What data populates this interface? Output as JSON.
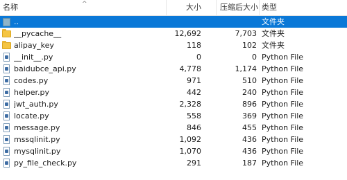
{
  "columns": {
    "name": "名称",
    "size": "大小",
    "compressed": "压缩后大小",
    "type": "类型"
  },
  "rows": [
    {
      "name": "..",
      "size": "",
      "compressed": "",
      "type": "文件夹",
      "icon": "parent-folder-icon"
    },
    {
      "name": "__pycache__",
      "size": "12,692",
      "compressed": "7,703",
      "type": "文件夹",
      "icon": "folder-icon"
    },
    {
      "name": "alipay_key",
      "size": "118",
      "compressed": "102",
      "type": "文件夹",
      "icon": "folder-icon"
    },
    {
      "name": "__init__.py",
      "size": "0",
      "compressed": "0",
      "type": "Python File",
      "icon": "python-file-icon"
    },
    {
      "name": "baidubce_api.py",
      "size": "4,778",
      "compressed": "1,174",
      "type": "Python File",
      "icon": "python-file-icon"
    },
    {
      "name": "codes.py",
      "size": "971",
      "compressed": "510",
      "type": "Python File",
      "icon": "python-file-icon"
    },
    {
      "name": "helper.py",
      "size": "442",
      "compressed": "240",
      "type": "Python File",
      "icon": "python-file-icon"
    },
    {
      "name": "jwt_auth.py",
      "size": "2,328",
      "compressed": "896",
      "type": "Python File",
      "icon": "python-file-icon"
    },
    {
      "name": "locate.py",
      "size": "558",
      "compressed": "369",
      "type": "Python File",
      "icon": "python-file-icon"
    },
    {
      "name": "message.py",
      "size": "846",
      "compressed": "455",
      "type": "Python File",
      "icon": "python-file-icon"
    },
    {
      "name": "mssqlinit.py",
      "size": "1,092",
      "compressed": "436",
      "type": "Python File",
      "icon": "python-file-icon"
    },
    {
      "name": "mysqlinit.py",
      "size": "1,070",
      "compressed": "436",
      "type": "Python File",
      "icon": "python-file-icon"
    },
    {
      "name": "py_file_check.py",
      "size": "291",
      "compressed": "187",
      "type": "Python File",
      "icon": "python-file-icon"
    }
  ],
  "selected_row": 0,
  "colors": {
    "selection": "#0a78d7",
    "folder": "#f5c542"
  }
}
